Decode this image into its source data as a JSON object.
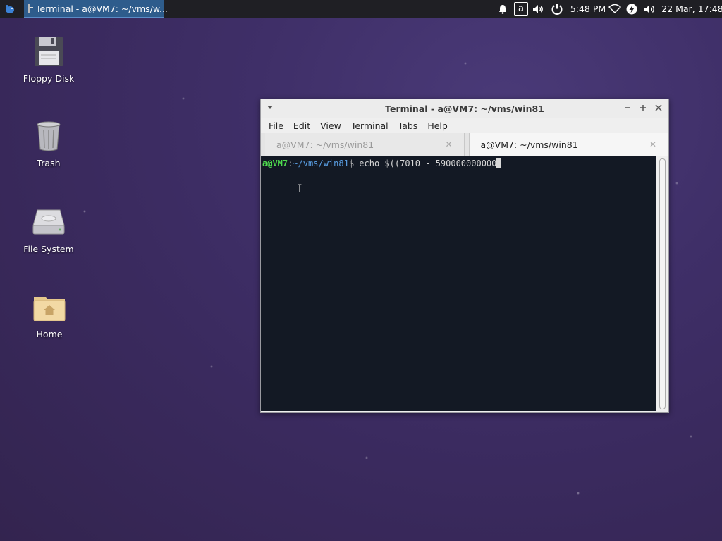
{
  "panel": {
    "taskbar_item": "Terminal - a@VM7: ~/vms/w...",
    "indicator_letter": "a",
    "time": "5:48 PM",
    "date": "22 Mar, 17:48"
  },
  "desktop": {
    "icons": [
      {
        "label": "Floppy Disk",
        "icon": "floppy-disk-icon"
      },
      {
        "label": "Trash",
        "icon": "trash-icon"
      },
      {
        "label": "File System",
        "icon": "hard-drive-icon"
      },
      {
        "label": "Home",
        "icon": "home-folder-icon"
      }
    ]
  },
  "window": {
    "title": "Terminal - a@VM7: ~/vms/win81",
    "menu": [
      "File",
      "Edit",
      "View",
      "Terminal",
      "Tabs",
      "Help"
    ],
    "tabs": [
      {
        "label": "a@VM7: ~/vms/win81",
        "active": false
      },
      {
        "label": "a@VM7: ~/vms/win81",
        "active": true
      }
    ],
    "prompt": {
      "user": "a@VM7",
      "sep": ":",
      "path": "~/vms/win81",
      "symbol": "$",
      "command": " echo $((7010 - 590000000000"
    }
  },
  "colors": {
    "accent": "#2e5c8c",
    "terminal_bg": "#131924",
    "prompt_user": "#4edc4e",
    "prompt_path": "#5aa0e6"
  }
}
